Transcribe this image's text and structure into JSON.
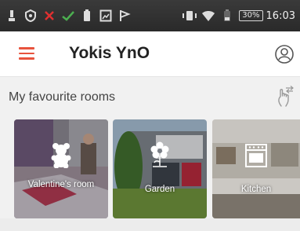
{
  "status_bar": {
    "battery_percent": "30%",
    "time": "16:03",
    "icons": [
      "alert-icon",
      "shield-icon",
      "close-icon",
      "check-icon",
      "battery-small-icon",
      "image-icon",
      "flag-icon",
      "vibrate-icon",
      "wifi-icon",
      "battery-icon"
    ]
  },
  "app_bar": {
    "title": "Yokis YnO",
    "menu_icon": "hamburger-menu-icon",
    "account_icon": "account-icon",
    "accent_color": "#e8533d"
  },
  "favourites": {
    "title": "My favourite rooms",
    "swipe_icon": "swipe-hand-icon",
    "rooms": [
      {
        "label": "Valentine's room",
        "icon": "teddy-bear-icon"
      },
      {
        "label": "Garden",
        "icon": "garden-flower-icon"
      },
      {
        "label": "Kitchen",
        "icon": "oven-icon"
      }
    ]
  }
}
